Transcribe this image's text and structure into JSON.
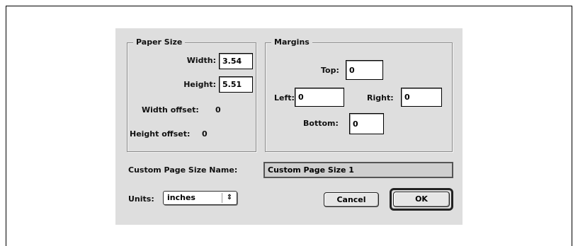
{
  "paper_size": {
    "title": "Paper Size",
    "width_label": "Width:",
    "width_value": "3.54",
    "height_label": "Height:",
    "height_value": "5.51",
    "width_offset_label": "Width offset:",
    "width_offset_value": "0",
    "height_offset_label": "Height offset:",
    "height_offset_value": "0"
  },
  "margins": {
    "title": "Margins",
    "top_label": "Top:",
    "top_value": "0",
    "left_label": "Left:",
    "left_value": "0",
    "right_label": "Right:",
    "right_value": "0",
    "bottom_label": "Bottom:",
    "bottom_value": "0"
  },
  "custom_name": {
    "label": "Custom Page Size Name:",
    "value": "Custom Page Size 1"
  },
  "units": {
    "label": "Units:",
    "selected": "inches",
    "arrows_icon": "up-down-arrows-icon"
  },
  "buttons": {
    "cancel": "Cancel",
    "ok": "OK"
  },
  "colors": {
    "dialog_background": "#dedede",
    "name_field_background": "#cfcfcf"
  }
}
